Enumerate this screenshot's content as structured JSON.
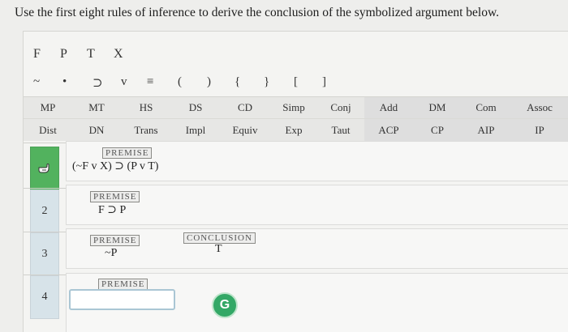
{
  "instruction": "Use the first eight rules of inference to derive the conclusion of the symbolized argument below.",
  "variables": [
    "F",
    "P",
    "T",
    "X"
  ],
  "symbols": [
    "~",
    "•",
    "⊃",
    "v",
    "≡",
    "(",
    ")",
    "{",
    "}",
    "[",
    "]"
  ],
  "rules_row1": [
    "MP",
    "MT",
    "HS",
    "DS",
    "CD",
    "Simp",
    "Conj",
    "Add",
    "DM",
    "Com",
    "Assoc"
  ],
  "rules_row2": [
    "Dist",
    "DN",
    "Trans",
    "Impl",
    "Equiv",
    "Exp",
    "Taut",
    "ACP",
    "CP",
    "AIP",
    "IP"
  ],
  "lines": [
    {
      "number": "",
      "tag": "PREMISE",
      "formula": "(~F v X) ⊃ (P v T)"
    },
    {
      "number": "2",
      "tag": "PREMISE",
      "formula": "F ⊃ P"
    },
    {
      "number": "3",
      "tag": "PREMISE",
      "formula": "~P",
      "conclusion_tag": "CONCLUSION",
      "conclusion": "T"
    },
    {
      "number": "4",
      "tag": "PREMISE",
      "input_value": ""
    }
  ],
  "go_button_label": "G",
  "colors": {
    "active_line": "#52b25e",
    "line_number_bg": "#d7e3e9",
    "go_button": "#33a866"
  },
  "icons": {
    "line1": "pointing-hand-icon"
  }
}
